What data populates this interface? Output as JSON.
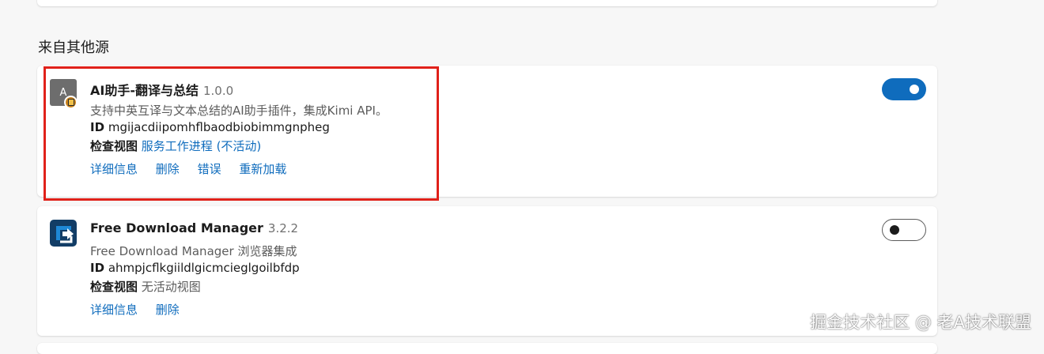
{
  "section": {
    "title": "来自其他源"
  },
  "extensions": [
    {
      "icon_letter": "A",
      "icon": "ai-assistant-icon",
      "name": "AI助手-翻译与总结",
      "version": "1.0.0",
      "description": "支持中英互译与文本总结的AI助手插件，集成Kimi API。",
      "id_label": "ID",
      "id": "mgijacdiipomhflbaodbiobimmgnpheg",
      "inspect_label": "检查视图",
      "inspect_value": "服务工作进程 (不活动)",
      "actions": [
        "详细信息",
        "删除",
        "错误",
        "重新加载"
      ],
      "enabled": true
    },
    {
      "icon": "free-download-manager-icon",
      "name": "Free Download Manager",
      "version": "3.2.2",
      "description": "Free Download Manager 浏览器集成",
      "id_label": "ID",
      "id": "ahmpjcflkgiildlgicmcieglgoilbfdp",
      "inspect_label": "检查视图",
      "inspect_value": "无活动视图",
      "actions": [
        "详细信息",
        "删除"
      ],
      "enabled": false
    }
  ],
  "watermark": "掘金技术社区 @ 老A技术联盟",
  "colors": {
    "accent": "#0f6cbd",
    "highlight": "#e0211a",
    "fdm_blue": "#1e88d6",
    "fdm_navy": "#123d66"
  }
}
